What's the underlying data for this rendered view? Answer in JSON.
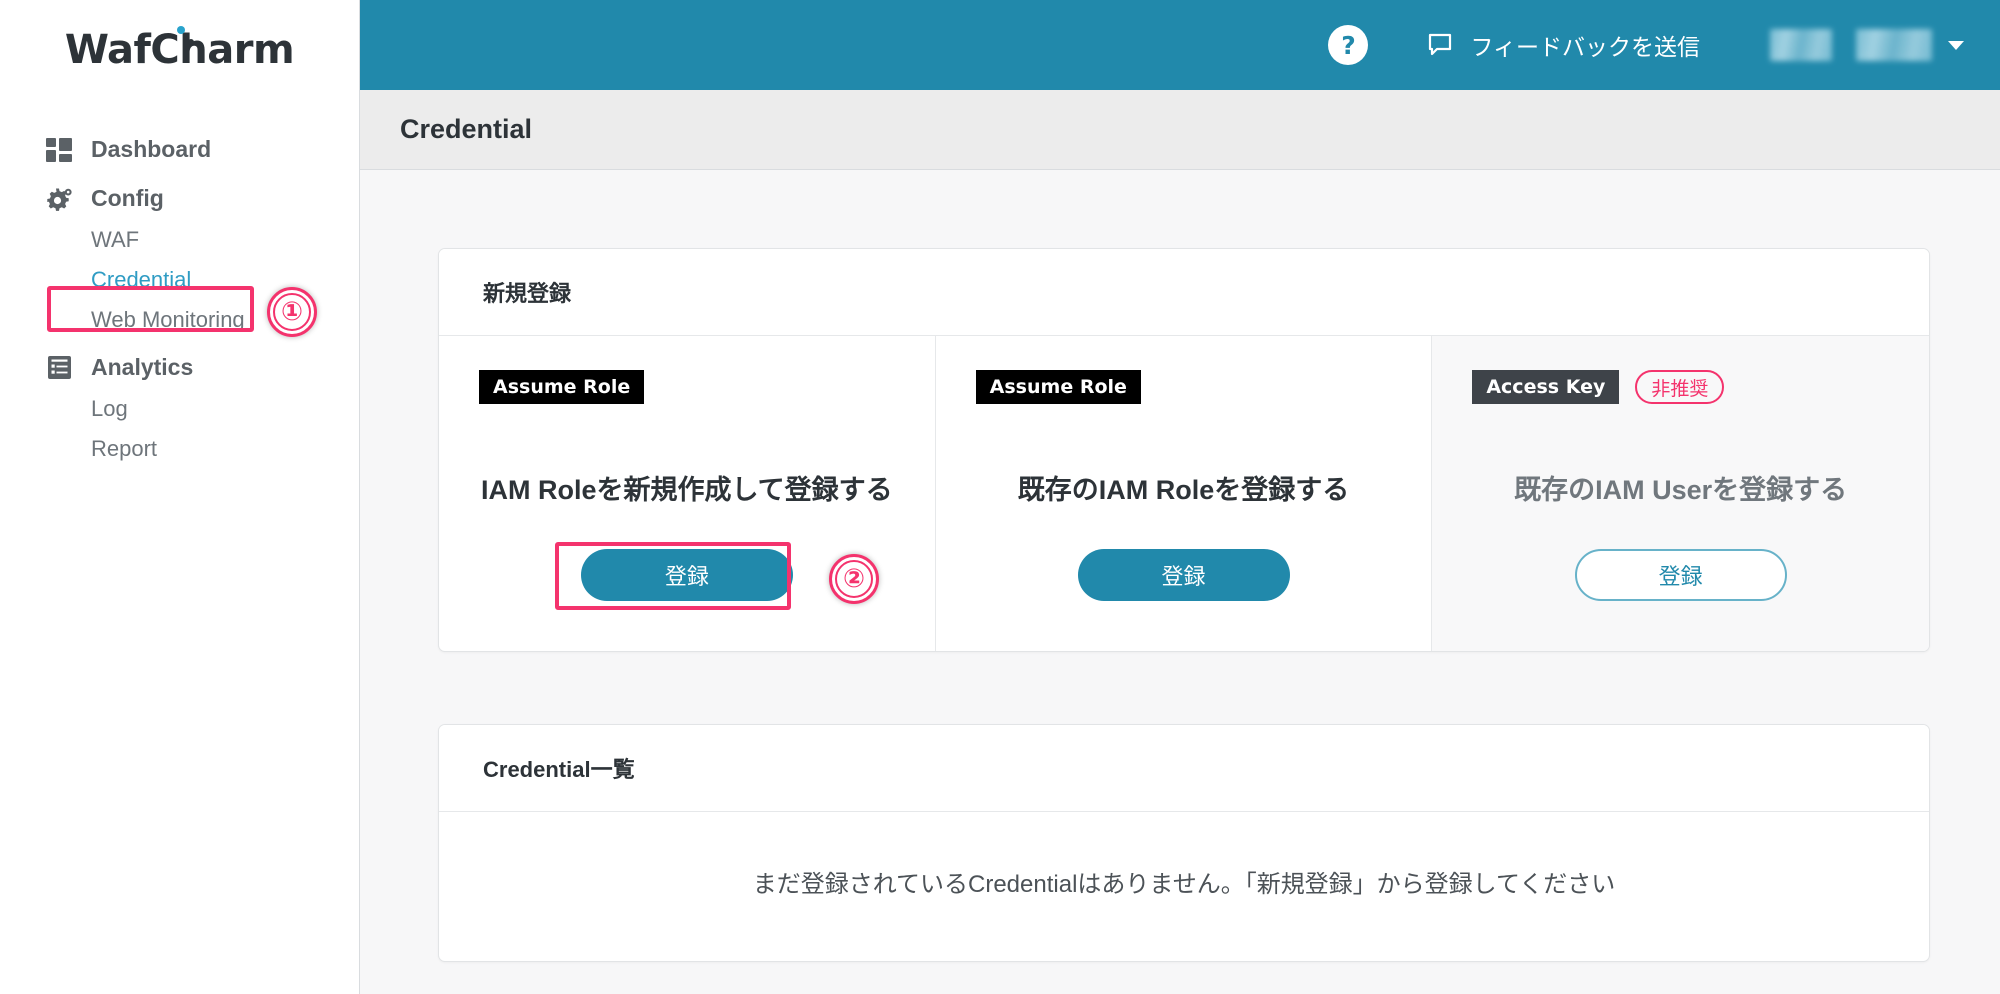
{
  "brand": {
    "name_part1": "Waf",
    "name_part2": "Charm"
  },
  "sidebar": {
    "items": [
      {
        "label": "Dashboard",
        "icon": "dashboard-grid-icon"
      },
      {
        "label": "Config",
        "icon": "gear-icon"
      },
      {
        "label": "Analytics",
        "icon": "clipboard-list-icon"
      }
    ],
    "config_children": [
      {
        "label": "WAF",
        "active": false
      },
      {
        "label": "Credential",
        "active": true
      },
      {
        "label": "Web Monitoring",
        "active": false
      }
    ],
    "analytics_children": [
      {
        "label": "Log",
        "active": false
      },
      {
        "label": "Report",
        "active": false
      }
    ]
  },
  "topbar": {
    "help_label": "?",
    "help_icon": "question-mark-icon",
    "feedback_label": "フィードバックを送信",
    "feedback_icon": "speech-bubble-icon",
    "user_name_masked": "",
    "caret_icon": "chevron-down-icon"
  },
  "page": {
    "title": "Credential"
  },
  "new_registration": {
    "header": "新規登録",
    "cards": [
      {
        "badge": "Assume Role",
        "badge_style": "black",
        "warning_badge": null,
        "title": "IAM Roleを新規作成して登録する",
        "button_label": "登録",
        "button_style": "primary",
        "highlighted": true
      },
      {
        "badge": "Assume Role",
        "badge_style": "black",
        "warning_badge": null,
        "title": "既存のIAM Roleを登録する",
        "button_label": "登録",
        "button_style": "primary",
        "highlighted": false
      },
      {
        "badge": "Access Key",
        "badge_style": "gray",
        "warning_badge": "非推奨",
        "title": "既存のIAM Userを登録する",
        "button_label": "登録",
        "button_style": "ghost",
        "highlighted": false
      }
    ]
  },
  "credential_list": {
    "header": "Credential一覧",
    "empty_message": "まだ登録されているCredentialはありません。「新規登録」から登録してください"
  },
  "annotations": [
    {
      "number": "①",
      "target": "sidebar-item-credential"
    },
    {
      "number": "②",
      "target": "register-button-new-iam-role"
    }
  ],
  "colors": {
    "accent_teal": "#2189ab",
    "annotation_pink": "#f4336d",
    "sidebar_active": "#2f9cc4",
    "badge_black": "#000000",
    "badge_gray": "#3e4349"
  }
}
